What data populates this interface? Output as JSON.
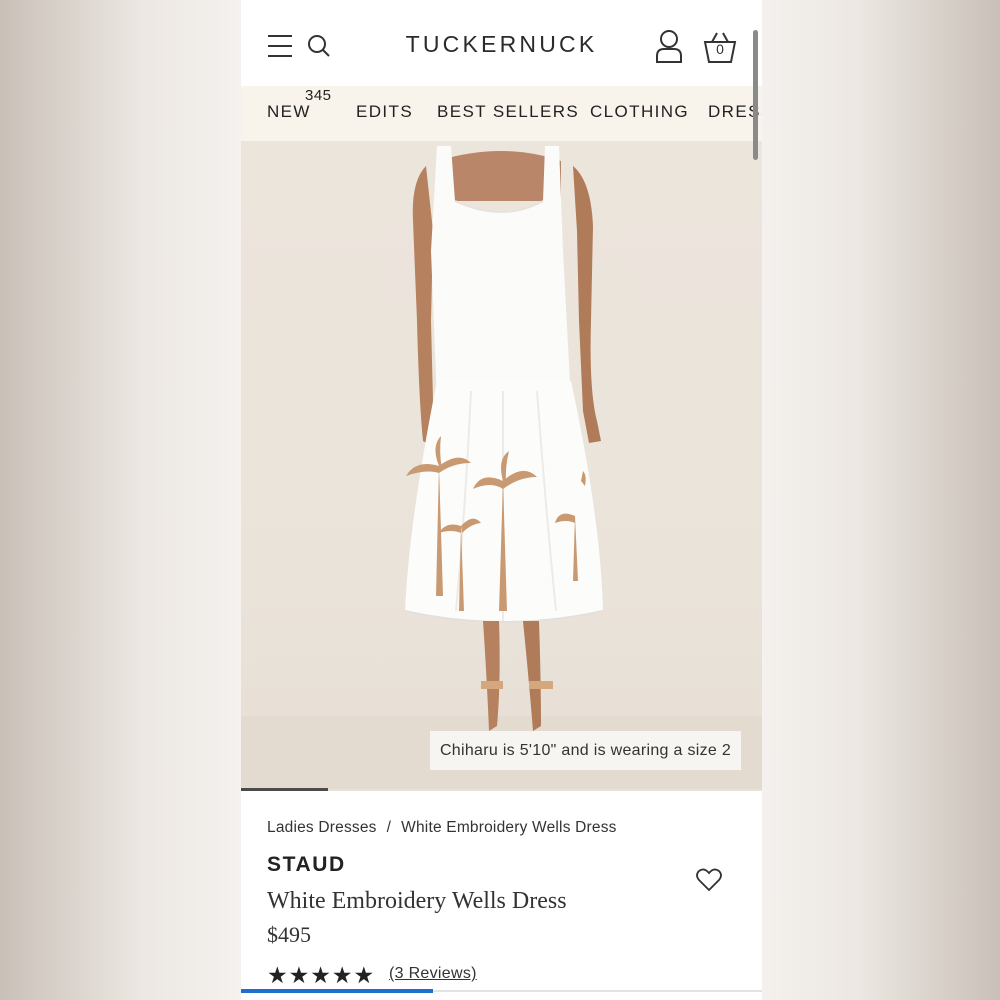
{
  "header": {
    "logo": "TUCKERNUCK",
    "cart_count": "0",
    "icons": [
      "menu-icon",
      "search-icon",
      "account-icon",
      "cart-icon"
    ]
  },
  "nav": {
    "items": [
      {
        "label": "NEW",
        "badge": "345"
      },
      {
        "label": "EDITS"
      },
      {
        "label": "BEST SELLERS"
      },
      {
        "label": "CLOTHING"
      },
      {
        "label": "DRESS"
      }
    ]
  },
  "hero": {
    "caption": "Chiharu is 5'10\" and is wearing a size 2"
  },
  "breadcrumb": {
    "items": [
      "Ladies Dresses",
      "White Embroidery Wells Dress"
    ],
    "separator": "/"
  },
  "product": {
    "brand": "STAUD",
    "name": "White Embroidery Wells Dress",
    "price": "$495",
    "rating_stars": "★★★★★",
    "reviews": "(3 Reviews)"
  },
  "colors": {
    "nav_bg": "#f8f4ec",
    "accent": "#1f6fd1",
    "text": "#222222"
  }
}
